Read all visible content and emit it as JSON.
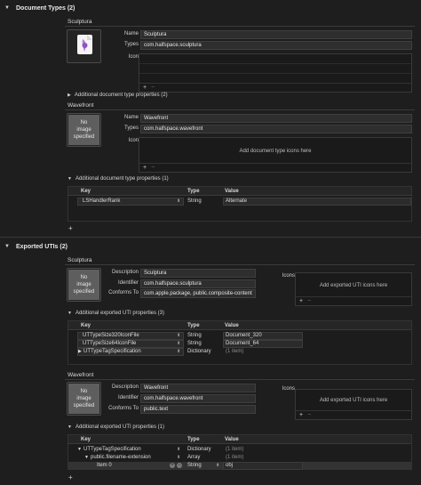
{
  "doc_types": {
    "header": "Document Types (2)",
    "items": [
      {
        "title": "Sculptura",
        "name_label": "Name",
        "name_value": "Sculptura",
        "types_label": "Types",
        "types_value": "com.halfspace.sculptura",
        "icon_label": "Icon",
        "props_label": "Additional document type properties (2)"
      },
      {
        "title": "Wavefront",
        "no_image": [
          "No",
          "image",
          "specified"
        ],
        "name_label": "Name",
        "name_value": "Wavefront",
        "types_label": "Types",
        "types_value": "com.halfspace.wavefront",
        "icon_label": "Icon",
        "icons_hint": "Add document type icons here",
        "props_label": "Additional document type properties (1)",
        "table": {
          "columns": [
            "Key",
            "Type",
            "Value"
          ],
          "rows": [
            {
              "key": "LSHandlerRank",
              "type": "String",
              "value": "Alternate"
            }
          ]
        }
      }
    ]
  },
  "exported_utis": {
    "header": "Exported UTIs (2)",
    "items": [
      {
        "title": "Sculptura",
        "no_image": [
          "No",
          "image",
          "specified"
        ],
        "description_label": "Description",
        "description_value": "Sculptura",
        "identifier_label": "Identifier",
        "identifier_value": "com.halfspace.sculptura",
        "conforms_label": "Conforms To",
        "conforms_value": "com.apple.package, public.composite-content",
        "icons_label": "Icons",
        "icons_hint": "Add exported UTI icons here",
        "props_label": "Additional exported UTI properties (3)",
        "table": {
          "columns": [
            "Key",
            "Type",
            "Value"
          ],
          "rows": [
            {
              "key": "UTTypeSize320IconFile",
              "type": "String",
              "value": "Document_320"
            },
            {
              "key": "UTTypeSize64IconFile",
              "type": "String",
              "value": "Document_64"
            },
            {
              "key": "UTTypeTagSpecification",
              "type": "Dictionary",
              "value": "(1 item)"
            }
          ]
        }
      },
      {
        "title": "Wavefront",
        "no_image": [
          "No",
          "image",
          "specified"
        ],
        "description_label": "Description",
        "description_value": "Wavefront",
        "identifier_label": "Identifier",
        "identifier_value": "com.halfspace.wavefront",
        "conforms_label": "Conforms To",
        "conforms_value": "public.text",
        "icons_label": "Icons",
        "icons_hint": "Add exported UTI icons here",
        "props_label": "Additional exported UTI properties (1)",
        "table": {
          "columns": [
            "Key",
            "Type",
            "Value"
          ],
          "rows": [
            {
              "key": "UTTypeTagSpecification",
              "type": "Dictionary",
              "value": "(1 item)"
            },
            {
              "key": "public.filename-extension",
              "type": "Array",
              "value": "(1 item)"
            },
            {
              "key": "Item 0",
              "type": "String",
              "value": "obj"
            }
          ]
        }
      }
    ]
  },
  "icons": {
    "disclosure_open": "▼",
    "disclosure_closed": "▶",
    "add": "+",
    "remove": "−",
    "stepper": "⬍"
  },
  "colors": {
    "background": "#1e1e1e",
    "field": "#2e2e2e",
    "no_image_bg": "#5e5e5e",
    "app_icon": "#b57cd8"
  }
}
